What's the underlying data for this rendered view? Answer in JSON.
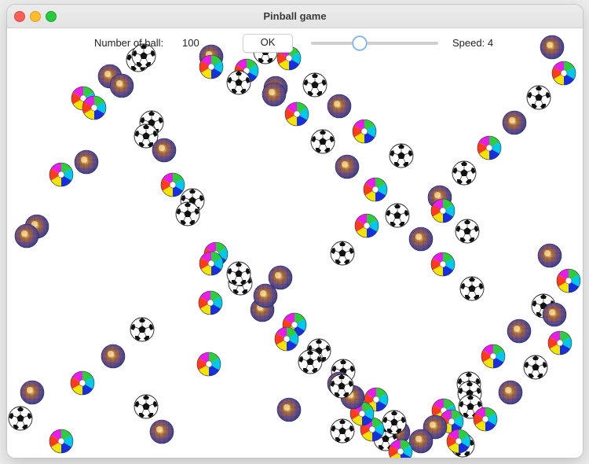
{
  "window": {
    "title": "Pinball game"
  },
  "controls": {
    "ball_count_label": "Number of ball:",
    "ball_count_value": "100",
    "ok_label": "OK",
    "speed_label": "Speed: 4",
    "speed_level": 0.4
  },
  "ball_types": [
    "beach-ball",
    "soccer-ball",
    "disco-ball"
  ]
}
